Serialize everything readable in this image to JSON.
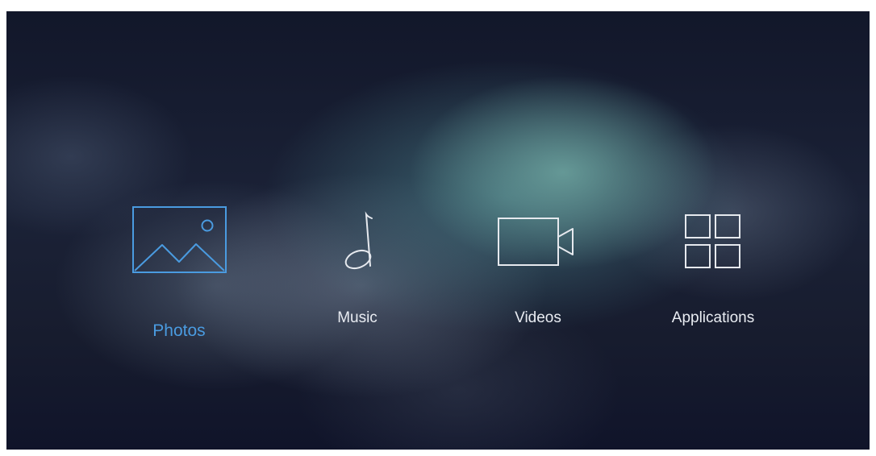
{
  "colors": {
    "selected_accent": "#4a9be0",
    "normal_text": "#e9ecf2",
    "icon_stroke": "#e6e9ee"
  },
  "menu": {
    "selected_index": 0,
    "items": [
      {
        "label": "Photos",
        "icon": "photo-icon",
        "selected": true
      },
      {
        "label": "Music",
        "icon": "music-note-icon",
        "selected": false
      },
      {
        "label": "Videos",
        "icon": "video-camera-icon",
        "selected": false
      },
      {
        "label": "Applications",
        "icon": "grid-apps-icon",
        "selected": false
      }
    ]
  }
}
